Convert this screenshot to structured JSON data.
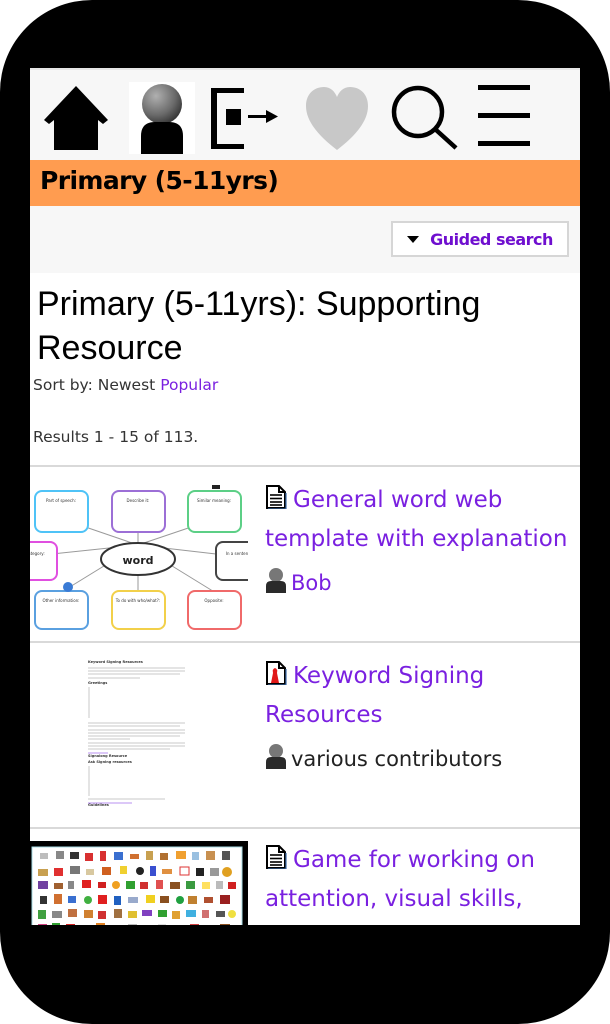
{
  "nav": {
    "items": [
      {
        "name": "home",
        "icon": "home-icon"
      },
      {
        "name": "profile",
        "icon": "avatar-icon"
      },
      {
        "name": "logout",
        "icon": "logout-icon"
      },
      {
        "name": "favourites",
        "icon": "heart-icon"
      },
      {
        "name": "search",
        "icon": "search-icon"
      },
      {
        "name": "menu",
        "icon": "hamburger-menu-icon"
      }
    ]
  },
  "section": {
    "title": "Primary (5-11yrs)",
    "color": "#ff9c50"
  },
  "guided_search": {
    "label": "Guided search",
    "icon": "caret-down-icon"
  },
  "page": {
    "title": "Primary (5-11yrs): Supporting Resource",
    "sort_label": "Sort by:",
    "sort_options": [
      {
        "label": "Newest",
        "active": true
      },
      {
        "label": "Popular",
        "active": false
      }
    ],
    "results_text": "Results 1 - 15 of 113."
  },
  "results": [
    {
      "title": "General word web template with explanation",
      "type_icon": "document-icon",
      "author": "Bob",
      "author_is_link": true,
      "thumbnail": {
        "kind": "word-web",
        "center_word": "word",
        "boxes": [
          "Part of speech:",
          "Describe it:",
          "Similar meaning:",
          "Category:",
          "In a sentence:",
          "Other information:",
          "To do with who/what?:",
          "Opposite:"
        ]
      }
    },
    {
      "title": "Keyword Signing Resources",
      "type_icon": "pdf-document-icon",
      "author": "various contributors",
      "author_is_link": false,
      "thumbnail": {
        "kind": "document-page",
        "headings": [
          "Keyword Signing Resources",
          "Greetings",
          "Signalong Resource",
          "Ask Signing resources",
          "Guidelines"
        ]
      }
    },
    {
      "title": "Game for working on attention, visual skills,",
      "type_icon": "document-icon",
      "author": "",
      "author_is_link": false,
      "thumbnail": {
        "kind": "picture-grid"
      }
    }
  ],
  "colors": {
    "link": "#7a20e0",
    "guided_label": "#6f0fcf",
    "nav_bg": "#f7f7f7",
    "separator": "#d9d9d9"
  }
}
